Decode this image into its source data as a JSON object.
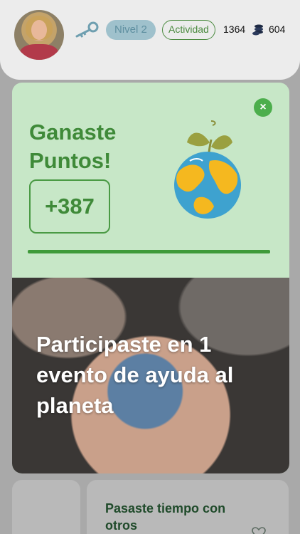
{
  "header": {
    "level_label": "Nivel 2",
    "activity_label": "Actividad",
    "points_count": "1364",
    "coins_count": "604"
  },
  "reward": {
    "title": "Ganaste Puntos!",
    "points_gained": "+387",
    "close_symbol": "×",
    "message": "Participaste en 1 evento de ayuda al planeta"
  },
  "cards": {
    "bottom_title": "Pasaste tiempo con otros"
  },
  "colors": {
    "accent_green": "#3f8a39",
    "reward_bg": "#c7e7c7",
    "level_badge_bg": "#9fc1cc"
  },
  "icons": [
    "key-icon",
    "coins-icon",
    "close-icon",
    "globe-sprout-icon",
    "heart-icon"
  ]
}
